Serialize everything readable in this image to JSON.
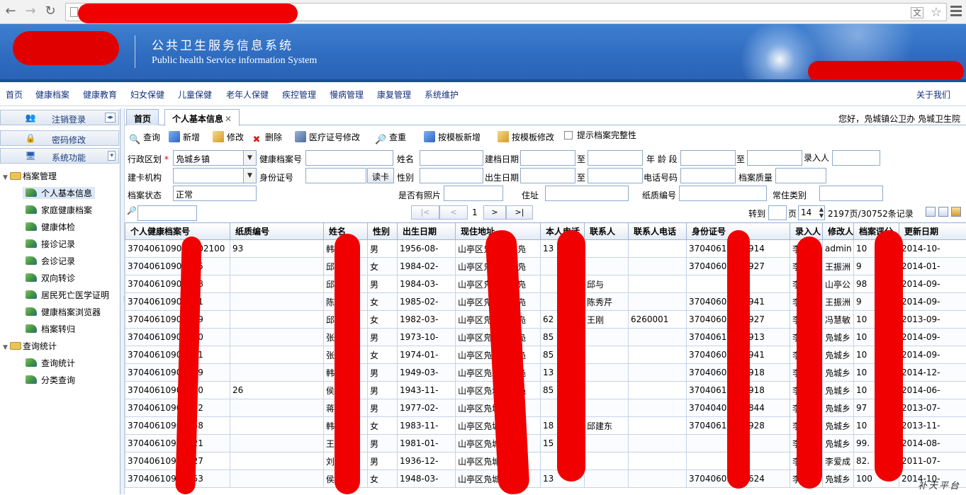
{
  "browser": {
    "back_icon": "back-arrow-icon",
    "forward_icon": "forward-arrow-icon",
    "reload_icon": "reload-icon"
  },
  "banner": {
    "title_cn": "公共卫生服务信息系统",
    "title_en": "Public health Service information System"
  },
  "top_menu": {
    "items": [
      "首页",
      "健康档案",
      "健康教育",
      "妇女保健",
      "儿童保健",
      "老年人保健",
      "疾控管理",
      "慢病管理",
      "康复管理",
      "系统维护"
    ],
    "about": "关于我们"
  },
  "sidebar": {
    "buttons": [
      {
        "label": "注销登录",
        "icon": "users-icon"
      },
      {
        "label": "密码修改",
        "icon": "lock-icon"
      },
      {
        "label": "系统功能",
        "icon": "computer-icon"
      }
    ],
    "groups": [
      {
        "label": "档案管理",
        "items": [
          "个人基本信息",
          "家庭健康档案",
          "健康体检",
          "接诊记录",
          "会诊记录",
          "双向转诊",
          "居民死亡医学证明",
          "健康档案浏览器",
          "档案转归"
        ]
      },
      {
        "label": "查询统计",
        "items": [
          "查询统计",
          "分类查询"
        ]
      }
    ]
  },
  "tabs": [
    "首页",
    "个人基本信息"
  ],
  "greeting": "您好，凫城镇公卫办  凫城卫生院",
  "toolbar": {
    "items": [
      {
        "label": "查询",
        "icon": "search-icon"
      },
      {
        "label": "新增",
        "icon": "add-icon"
      },
      {
        "label": "修改",
        "icon": "edit-icon"
      },
      {
        "label": "删除",
        "icon": "delete-icon"
      },
      {
        "label": "医疗证号修改",
        "icon": "card-edit-icon"
      },
      {
        "label": "查重",
        "icon": "duplicate-check-icon"
      },
      {
        "label": "按模板新增",
        "icon": "template-add-icon"
      },
      {
        "label": "按模板修改",
        "icon": "template-edit-icon"
      },
      {
        "label": "提示档案完整性",
        "icon": "checkbox"
      }
    ]
  },
  "filters": {
    "region_label": "行政区划",
    "region_value": "凫城乡镇",
    "record_no_label": "健康档案号",
    "name_label": "姓名",
    "build_date_label": "建档日期",
    "to_label": "至",
    "age_label": "年 龄 段",
    "entry_person_label": "录入人",
    "org_label": "建卡机构",
    "id_label": "身份证号",
    "read_card": "读卡",
    "gender_label": "性别",
    "birth_label": "出生日期",
    "phone_label": "电话号码",
    "quality_label": "档案质量",
    "status_label": "档案状态",
    "status_value": "正常",
    "photo_label": "是否有照片",
    "address_label": "住址",
    "paper_label": "纸质编号",
    "resident_label": "常住类别"
  },
  "pager": {
    "first": "|<",
    "prev": "<",
    "page": "1",
    "next": ">",
    "last": ">|",
    "goto_label": "转到",
    "page_unit": "页",
    "page_size": "14",
    "summary": "2197页/30752条记录"
  },
  "table": {
    "headers": [
      "个人健康档案号",
      "纸质编号",
      "姓名",
      "性别",
      "出生日期",
      "现住地址",
      "本人电话",
      "联系人",
      "联系人电话",
      "身份证号",
      "录入人",
      "修改人",
      "档案评分",
      "更新日期"
    ],
    "rows": [
      [
        "370406109002202100",
        "93",
        "韩",
        "男",
        "1956-08-",
        "山亭区凫城镇西凫",
        "13",
        "",
        "",
        "37040618183914",
        "李",
        "admin",
        "10",
        "2014-10-"
      ],
      [
        "37040610902105",
        "",
        "邱",
        "女",
        "1984-02-",
        "山亭区凫城镇西凫",
        "",
        "",
        "",
        "37040602103927",
        "李",
        "王振洲",
        "9",
        "2014-01-"
      ],
      [
        "37040610902108",
        "",
        "邱",
        "男",
        "1984-03-",
        "山亭区凫城镇西凫",
        "",
        "邱与",
        "",
        "",
        "李",
        "山亭公",
        "98",
        "2014-09-"
      ],
      [
        "37040610902111",
        "",
        "陈",
        "女",
        "1985-02-",
        "山亭区凫城镇西凫",
        "",
        "陈秀芹",
        "",
        "37040602043941",
        "李",
        "王振洲",
        "9",
        "2014-09-"
      ],
      [
        "37040610902129",
        "",
        "邱",
        "女",
        "1982-03-",
        "山亭区凫城镇西凫",
        "62",
        "王刚",
        "6260001",
        "37040603083927",
        "李",
        "冯慧敏",
        "10",
        "2013-09-"
      ],
      [
        "37040610902140",
        "",
        "张",
        "男",
        "1973-10-",
        "山亭区凫城镇西凫",
        "85",
        "",
        "",
        "37040610053913",
        "李",
        "凫城乡",
        "10",
        "2014-09-"
      ],
      [
        "37040610902141",
        "",
        "张",
        "女",
        "1974-01-",
        "山亭区凫城镇西凫",
        "85",
        "",
        "",
        "37040601283941",
        "李",
        "凫城乡",
        "10",
        "2014-09-"
      ],
      [
        "37040610902149",
        "",
        "韩",
        "男",
        "1949-03-",
        "山亭区凫城镇西凫",
        "13",
        "",
        "",
        "37040603193918",
        "李",
        "凫城乡",
        "10",
        "2014-12-"
      ],
      [
        "37040610902150",
        "26",
        "侯",
        "男",
        "1943-11-",
        "山亭区凫城镇西凫",
        "85",
        "",
        "",
        "37040611083918",
        "李",
        "凫城乡",
        "10",
        "2014-06-"
      ],
      [
        "37040610902152",
        "",
        "蒋",
        "男",
        "1977-02-",
        "山亭区凫城镇西凫",
        "",
        "",
        "",
        "37040402016844",
        "李",
        "凫城乡",
        "97",
        "2013-07-"
      ],
      [
        "37040610902158",
        "",
        "韩",
        "女",
        "1983-11-",
        "山亭区凫城镇西凫",
        "18",
        "邱建东",
        "",
        "37040611213928",
        "李",
        "凫城乡",
        "10",
        "2013-11-"
      ],
      [
        "37040610903021",
        "",
        "王明",
        "男",
        "1981-01-",
        "山亭区凫城镇崖庄",
        "15",
        "",
        "",
        "",
        "李",
        "凫城乡",
        "99.",
        "2014-08-"
      ],
      [
        "37040610903027",
        "",
        "刘安",
        "男",
        "1936-12-",
        "山亭区凫城镇崖庄",
        "",
        "",
        "",
        "",
        "李",
        "李爱成",
        "82.",
        "2011-07-"
      ],
      [
        "37040610903053",
        "",
        "侯志",
        "女",
        "1948-03-",
        "山亭区凫城镇崖庄",
        "13",
        "",
        "",
        "37040603183624",
        "李",
        "凫城乡",
        "100",
        "2014-10-"
      ]
    ]
  },
  "watermark": "补天平台"
}
